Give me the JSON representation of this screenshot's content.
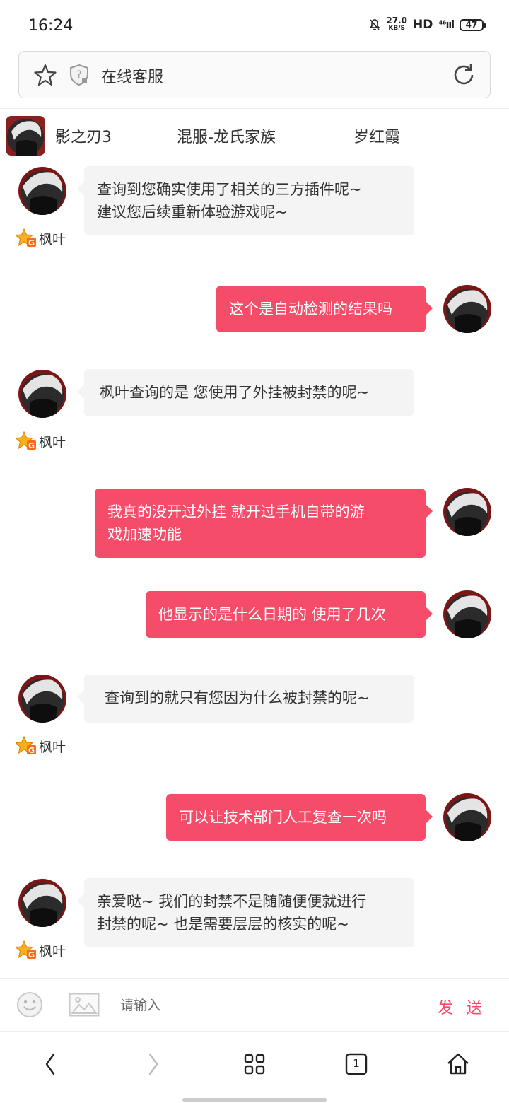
{
  "status_bar": {
    "time": "16:24",
    "speed_value": "27.0",
    "speed_unit": "KB/S",
    "hd": "HD",
    "signal": "⁴⁶ııl",
    "battery": "47"
  },
  "address_bar": {
    "title": "在线客服"
  },
  "game_tabs": {
    "game": "影之刃3",
    "server": "混服-龙氏家族",
    "character": "岁红霞"
  },
  "messages": [
    {
      "side": "agent",
      "lines": [
        "查询到您确实使用了相关的三方插件呢~",
        "建议您后续重新体验游戏呢~"
      ],
      "name": "枫叶"
    },
    {
      "side": "user",
      "lines": [
        "这个是自动检测的结果吗"
      ]
    },
    {
      "side": "agent",
      "lines": [
        "枫叶查询的是 您使用了外挂被封禁的呢~"
      ],
      "name": "枫叶"
    },
    {
      "side": "user",
      "lines": [
        "我真的没开过外挂 就开过手机自带的游",
        "戏加速功能"
      ]
    },
    {
      "side": "user",
      "lines": [
        "他显示的是什么日期的 使用了几次"
      ]
    },
    {
      "side": "agent",
      "lines": [
        "查询到的就只有您因为什么被封禁的呢~"
      ],
      "name": "枫叶"
    },
    {
      "side": "user",
      "lines": [
        "可以让技术部门人工复查一次吗"
      ]
    },
    {
      "side": "agent",
      "lines": [
        "亲爱哒~ 我们的封禁不是随随便便就进行",
        "封禁的呢~ 也是需要层层的核实的呢~"
      ],
      "name": "枫叶"
    }
  ],
  "input_bar": {
    "placeholder": "请输入",
    "send_label": "发 送"
  },
  "nav_bar": {
    "tab_count": "1",
    "icons": [
      "back-icon",
      "forward-icon",
      "menu-grid-icon",
      "tabs-icon",
      "home-icon"
    ]
  },
  "colors": {
    "user_bubble": "#f54c6a",
    "agent_bubble": "#f4f4f4",
    "send": "#f54c6a"
  }
}
